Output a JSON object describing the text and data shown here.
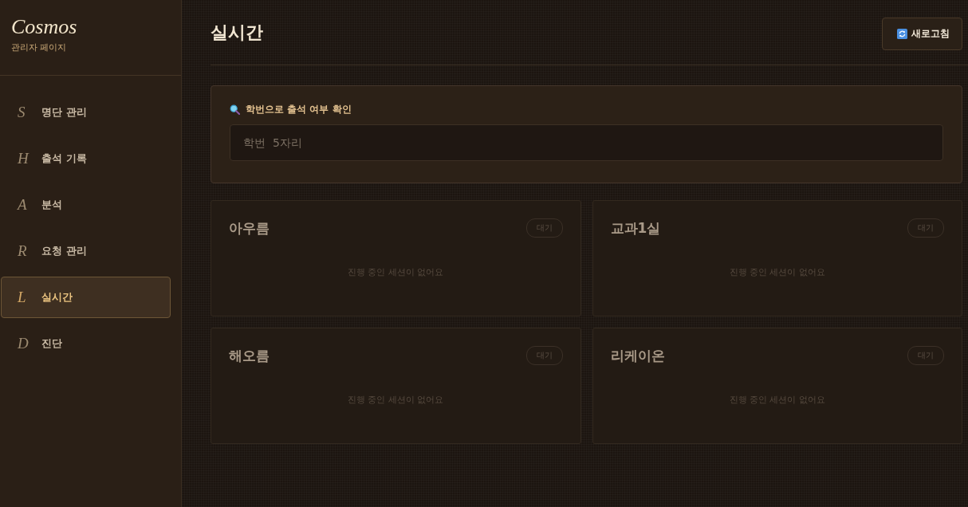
{
  "sidebar": {
    "brand": "Cosmos",
    "subtitle": "관리자 페이지",
    "items": [
      {
        "letter": "S",
        "label": "명단 관리",
        "selected": false
      },
      {
        "letter": "H",
        "label": "출석 기록",
        "selected": false
      },
      {
        "letter": "A",
        "label": "분석",
        "selected": false
      },
      {
        "letter": "R",
        "label": "요청 관리",
        "selected": false
      },
      {
        "letter": "L",
        "label": "실시간",
        "selected": true
      },
      {
        "letter": "D",
        "label": "진단",
        "selected": false
      }
    ]
  },
  "header": {
    "title": "실시간",
    "refresh_button": "새로고침"
  },
  "search": {
    "label": "학번으로 출석 여부 확인",
    "placeholder": "학번  5자리"
  },
  "rooms": [
    {
      "name": "아우름",
      "status": "대기",
      "message": "진행 중인 세션이 없어요"
    },
    {
      "name": "교과1실",
      "status": "대기",
      "message": "진행 중인 세션이 없어요"
    },
    {
      "name": "해오름",
      "status": "대기",
      "message": "진행 중인 세션이 없어요"
    },
    {
      "name": "리케이온",
      "status": "대기",
      "message": "진행 중인 세션이 없어요"
    }
  ]
}
